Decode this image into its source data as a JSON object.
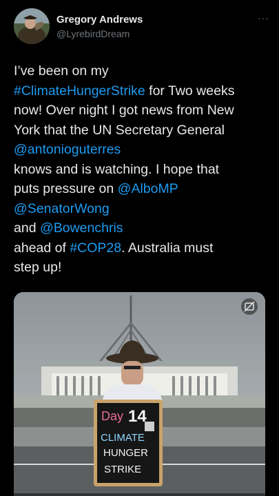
{
  "author": {
    "name": "Gregory Andrews",
    "handle": "@LyrebirdDream",
    "avatar_icon": "profile-photo-avatar",
    "more_icon": "more-options-icon",
    "more_glyph": "···"
  },
  "tweet": {
    "segments": [
      {
        "text": "I’ve been on my",
        "link": false
      },
      {
        "text": "#ClimateHungerStrike",
        "link": true
      },
      {
        "text": " for Two weeks",
        "link": false
      },
      {
        "text": "now! Over night I got news from New",
        "link": false
      },
      {
        "text": "York that the UN Secretary General",
        "link": false
      },
      {
        "text": "@antonioguterres",
        "link": true
      },
      {
        "text": "knows and is watching. I hope that",
        "link": false
      },
      {
        "text": "puts pressure on ",
        "link": false
      },
      {
        "text": "@AlboMP",
        "link": true
      },
      {
        "text": "@SenatorWong",
        "link": true
      },
      {
        "text": "and ",
        "link": false
      },
      {
        "text": "@Bowenchris",
        "link": true
      },
      {
        "text": "ahead of ",
        "link": false
      },
      {
        "text": "#COP28",
        "link": true
      },
      {
        "text": ". Australia must",
        "link": false
      },
      {
        "text": "step up!",
        "link": false
      }
    ]
  },
  "media": {
    "sign_day": "Day",
    "sign_number": "14",
    "sign_line1": "CLIMATE",
    "sign_line2": "HUNGER",
    "sign_line3": "STRIKE",
    "badge_icon": "media-sensitive-icon"
  },
  "colors": {
    "background": "#000000",
    "text": "#e7e9ea",
    "link": "#1d9bf0",
    "secondary": "#71767b"
  }
}
